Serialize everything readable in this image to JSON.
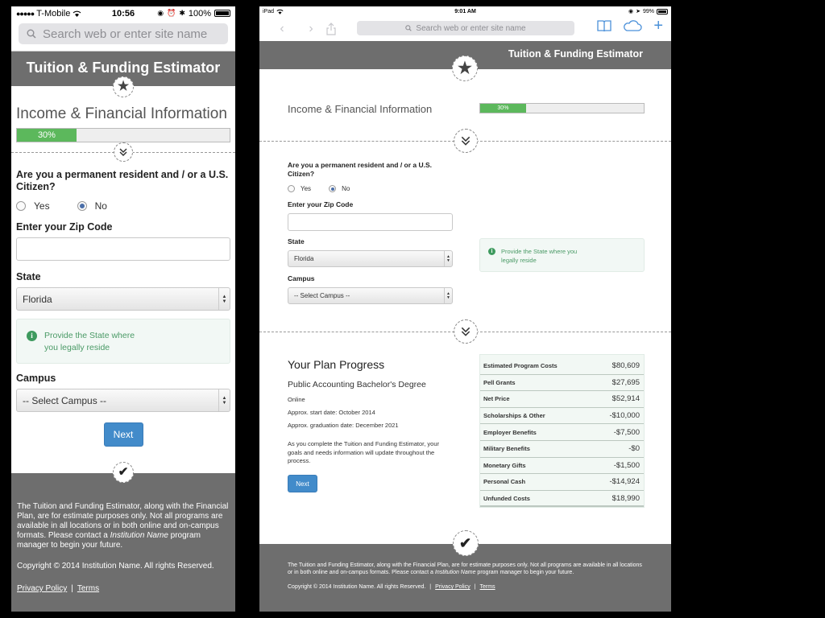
{
  "phone": {
    "status": {
      "carrier": "T-Mobile",
      "time": "10:56",
      "battery": "100%"
    },
    "url_placeholder": "Search web or enter site name",
    "header_title": "Tuition & Funding Estimator",
    "section_title": "Income & Financial Information",
    "progress": {
      "label": "30%",
      "value": 30
    },
    "question": "Are you a permanent resident and / or a U.S. Citizen?",
    "radio_yes": "Yes",
    "radio_no": "No",
    "radio_selected": "No",
    "zip_label": "Enter your Zip Code",
    "zip_value": "",
    "state_label": "State",
    "state_value": "Florida",
    "info_text": "Provide the State where you legally reside",
    "campus_label": "Campus",
    "campus_value": "-- Select Campus --",
    "next_label": "Next",
    "footer": {
      "disclaimer_pre": "The Tuition and Funding Estimator, along with the Financial Plan, are for estimate purposes only. Not all programs are available in all locations or in both online and on-campus formats. Please contact a ",
      "disclaimer_em": "Institution Name",
      "disclaimer_post": " program manager to begin your future.",
      "copyright": "Copyright © 2014 Institution Name. All rights Reserved.",
      "privacy": "Privacy Policy",
      "separator": "|",
      "terms": "Terms"
    }
  },
  "ipad": {
    "status": {
      "device": "iPad",
      "time": "9:01 AM",
      "battery": "99%"
    },
    "url_placeholder": "Search web or enter site name",
    "header_title": "Tuition & Funding Estimator",
    "section_title": "Income & Financial Information",
    "progress": {
      "label": "30%",
      "value": 30
    },
    "question": "Are you a permanent resident and / or a U.S. Citizen?",
    "radio_yes": "Yes",
    "radio_no": "No",
    "zip_label": "Enter your Zip Code",
    "state_label": "State",
    "state_value": "Florida",
    "campus_label": "Campus",
    "campus_value": "-- Select Campus --",
    "info_text": "Provide the State where you legally reside",
    "plan": {
      "title": "Your Plan Progress",
      "degree": "Public Accounting Bachelor's Degree",
      "format": "Online",
      "start": "Approx. start date: October 2014",
      "graduation": "Approx. graduation date: December 2021",
      "description": "As you complete the Tuition and Funding Estimator, your goals and needs information will update throughout the process.",
      "next_label": "Next"
    },
    "costs": [
      {
        "label": "Estimated Program Costs",
        "value": "$80,609"
      },
      {
        "label": "Pell Grants",
        "value": "$27,695"
      },
      {
        "label": "Net Price",
        "value": "$52,914"
      },
      {
        "label": "Scholarships & Other",
        "value": "-$10,000"
      },
      {
        "label": "Employer Benefits",
        "value": "-$7,500"
      },
      {
        "label": "Military Benefits",
        "value": "-$0"
      },
      {
        "label": "Monetary Gifts",
        "value": "-$1,500"
      },
      {
        "label": "Personal Cash",
        "value": "-$14,924"
      },
      {
        "label": "Unfunded Costs",
        "value": "$18,990"
      }
    ],
    "footer": {
      "disclaimer_pre": "The Tuition and Funding Estimator, along with the Financial Plan, are for estimate purposes only. Not all programs are available in all locations or in both online and on-campus formats. Please contact a ",
      "disclaimer_em": "Institution Name",
      "disclaimer_post": " program manager to begin your future.",
      "copyright": "Copyright © 2014 Institution Name. All rights Reserved.",
      "separator": "|",
      "privacy": "Privacy Policy",
      "terms": "Terms"
    }
  },
  "colors": {
    "header_bg": "#6e6e6e",
    "progress_fill": "#5cb85c",
    "button": "#428bca",
    "info_text": "#4a9a66",
    "ios_blue": "#4a90d9"
  }
}
